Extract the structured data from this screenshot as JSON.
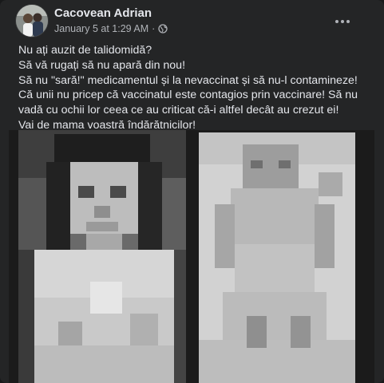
{
  "post": {
    "author": "Cacovean Adrian",
    "timestamp": "January 5 at 1:29 AM",
    "separator": "·",
    "audience_icon": "globe-icon",
    "menu_icon": "more-horizontal-icon",
    "lines": [
      "Nu ați auzit de talidomidă?",
      "Să vă rugați să nu apară din nou!",
      "Să nu \"sară!\" medicamentul și la nevaccinat și să nu-l contamineze!",
      "Că unii nu pricep că vaccinatul este contagios prin vaccinare! Să nu",
      "vadă cu ochii lor ceea ce au criticat că-i altfel decât au crezut ei!",
      "Vai de mama voastră îndărătnicilor!"
    ],
    "image": {
      "description_icon": "pixelated-photo",
      "panels": 2
    }
  },
  "colors": {
    "card_background": "#242526",
    "page_background": "#18191a",
    "primary_text": "#e4e6eb",
    "secondary_text": "#b0b3b8"
  }
}
